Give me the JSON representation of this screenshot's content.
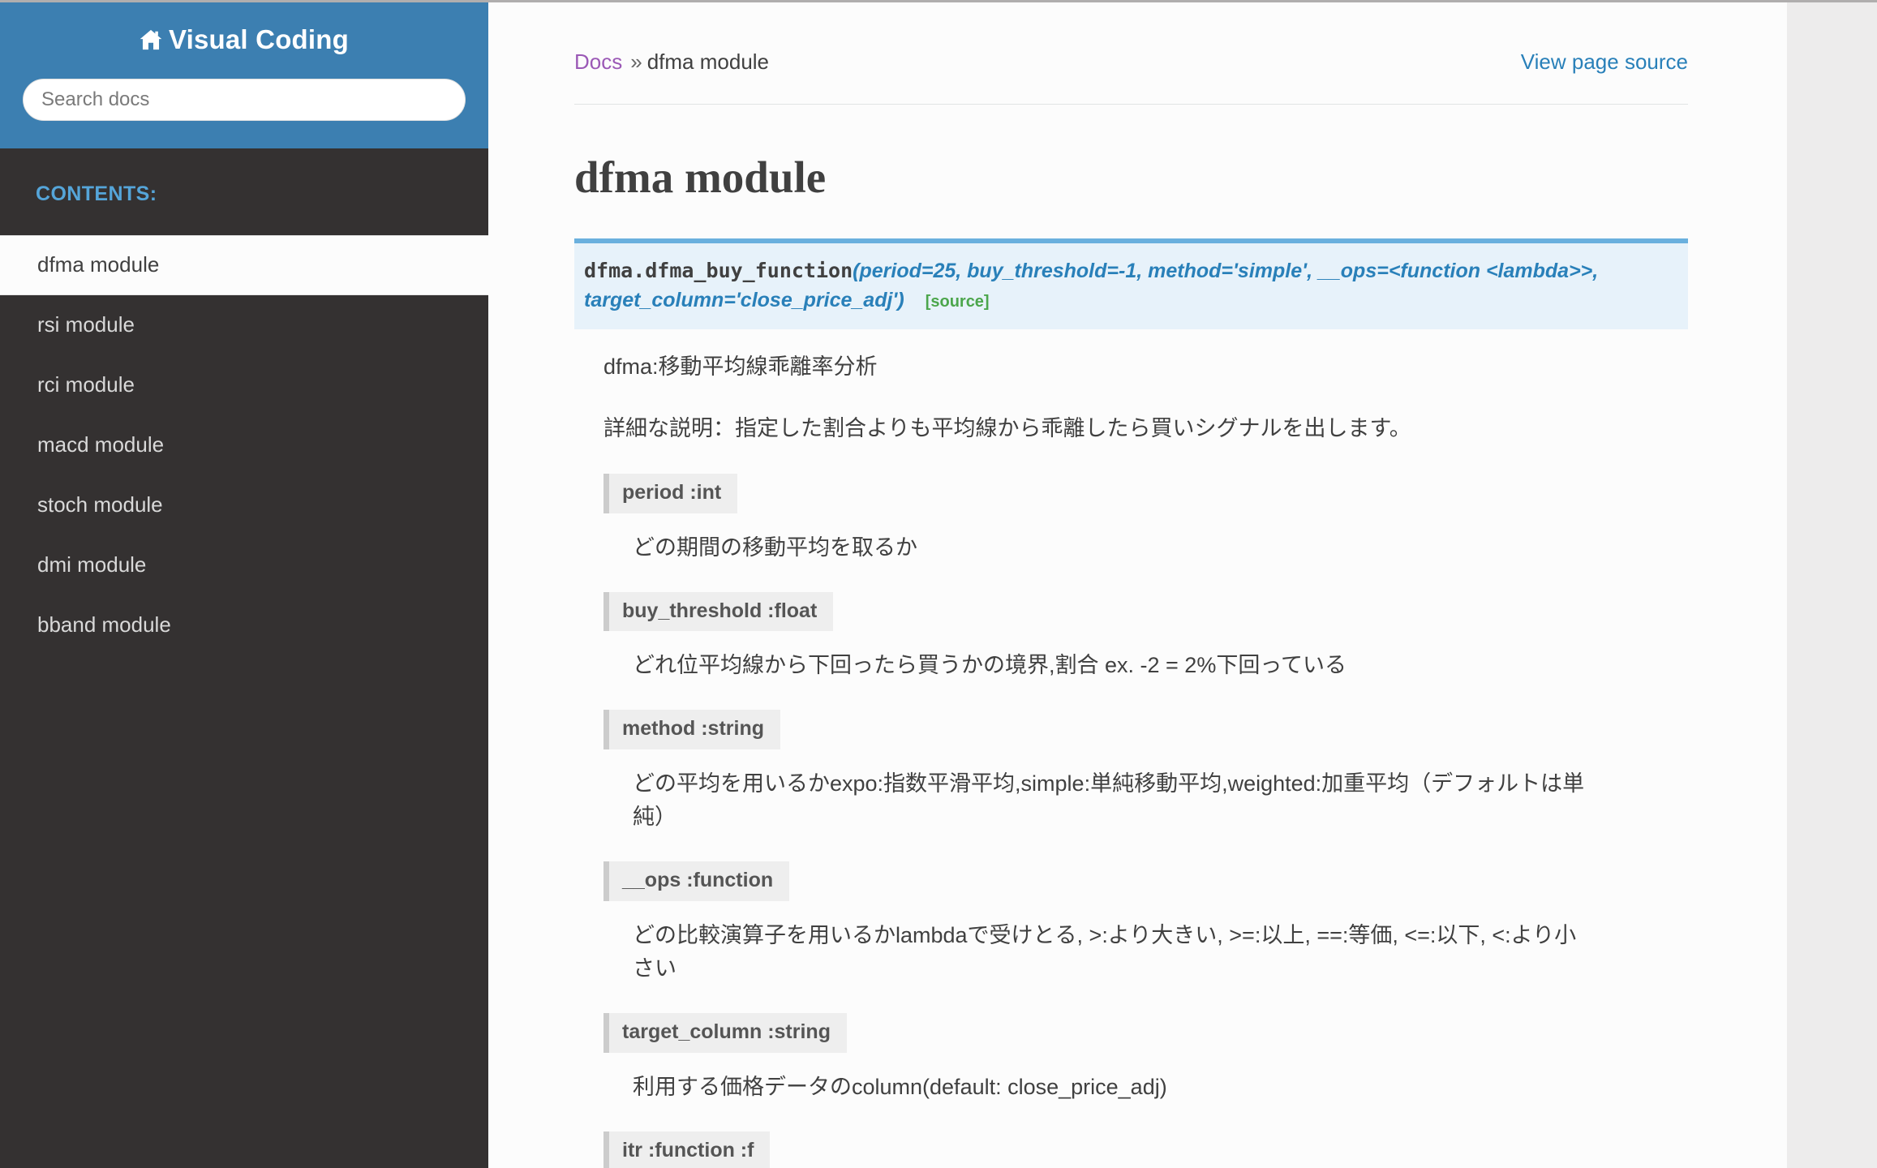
{
  "sidebar": {
    "brand": "Visual Coding",
    "brand_icon": "home-icon",
    "search": {
      "placeholder": "Search docs",
      "value": ""
    },
    "contents_label": "CONTENTS:",
    "items": [
      {
        "label": "dfma module",
        "current": true
      },
      {
        "label": "rsi module",
        "current": false
      },
      {
        "label": "rci module",
        "current": false
      },
      {
        "label": "macd module",
        "current": false
      },
      {
        "label": "stoch module",
        "current": false
      },
      {
        "label": "dmi module",
        "current": false
      },
      {
        "label": "bband module",
        "current": false
      }
    ]
  },
  "header": {
    "breadcrumb_root": "Docs",
    "breadcrumb_separator": "»",
    "breadcrumb_current": "dfma module",
    "view_page_source": "View page source"
  },
  "main": {
    "page_title": "dfma module",
    "signature": {
      "name": "dfma.dfma_buy_function",
      "params": "(period=25, buy_threshold=-1, method='simple', __ops=<function <lambda>>, target_column='close_price_adj')",
      "source_label": "[source]"
    },
    "summary": "dfma:移動平均線乖離率分析",
    "detail": "詳細な説明：指定した割合よりも平均線から乖離したら買いシグナルを出します。",
    "parameters": [
      {
        "tag": "period :int",
        "desc": "どの期間の移動平均を取るか"
      },
      {
        "tag": "buy_threshold :float",
        "desc": "どれ位平均線から下回ったら買うかの境界,割合 ex. -2 = 2%下回っている"
      },
      {
        "tag": "method :string",
        "desc": "どの平均を用いるかexpo:指数平滑平均,simple:単純移動平均,weighted:加重平均（デフォルトは単純）"
      },
      {
        "tag": "__ops :function",
        "desc": "どの比較演算子を用いるかlambdaで受けとる, >:より大きい, >=:以上, ==:等価, <=:以下, <:より小さい"
      },
      {
        "tag": "target_column :string",
        "desc": "利用する価格データのcolumn(default: close_price_adj)"
      },
      {
        "tag": "itr :function :f",
        "desc": ""
      }
    ]
  },
  "colors": {
    "sidebar_bg": "#343131",
    "sidebar_head_bg": "#3c7fb1",
    "accent_blue": "#2980b9",
    "signature_bg": "#e7f2fa",
    "signature_border": "#6ab0de",
    "source_green": "#4ca64c",
    "breadcrumb_link": "#9b59b6",
    "content_bg": "#fcfcfc",
    "page_bg": "#edecec"
  }
}
